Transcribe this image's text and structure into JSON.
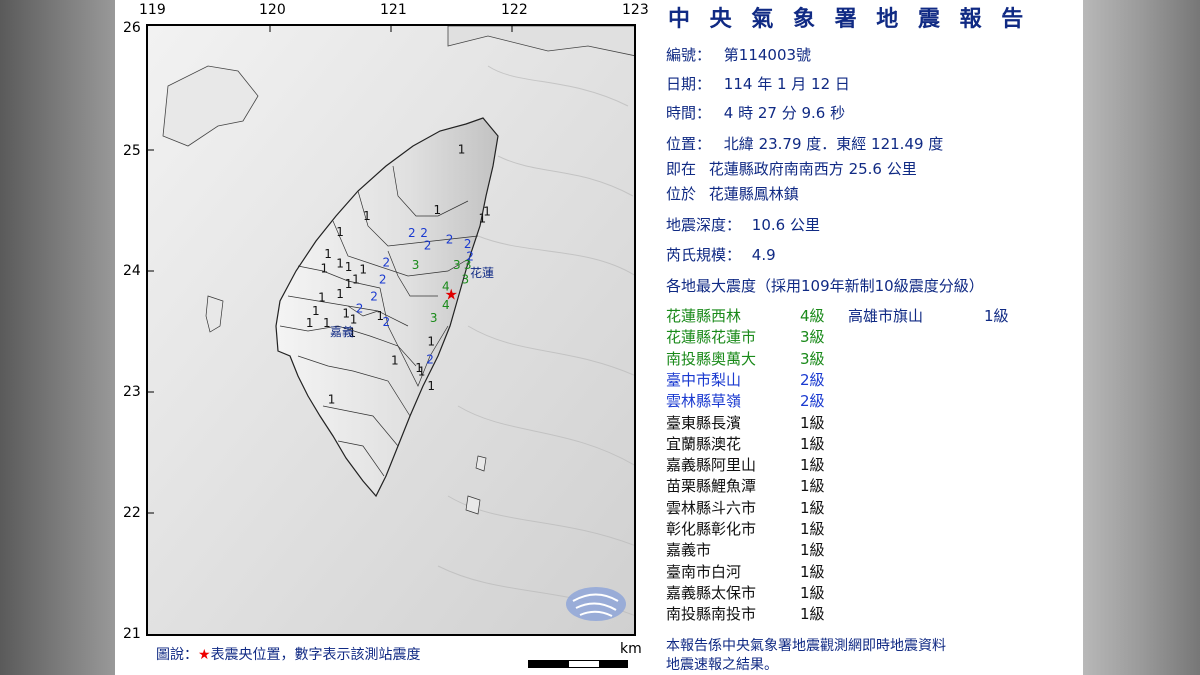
{
  "map": {
    "lon_ticks": [
      "119",
      "120",
      "121",
      "122",
      "123"
    ],
    "lat_ticks": [
      "26",
      "25",
      "24",
      "23",
      "22",
      "21"
    ],
    "epicenter_label": "花蓮",
    "city_label_chiayi": "嘉義",
    "legend_prefix": "圖說：",
    "legend_star": "★",
    "legend_text": "表震央位置，數字表示該測站震度",
    "scale_unit": "km",
    "stations": [
      {
        "v": "1",
        "lon": 121.55,
        "lat": 24.95
      },
      {
        "v": "1",
        "lon": 121.76,
        "lat": 24.44
      },
      {
        "v": "1",
        "lon": 121.72,
        "lat": 24.38
      },
      {
        "v": "1",
        "lon": 121.35,
        "lat": 24.45
      },
      {
        "v": "1",
        "lon": 120.77,
        "lat": 24.4
      },
      {
        "v": "1",
        "lon": 120.55,
        "lat": 24.27
      },
      {
        "v": "1",
        "lon": 120.45,
        "lat": 24.09
      },
      {
        "v": "1",
        "lon": 120.55,
        "lat": 24.01
      },
      {
        "v": "1",
        "lon": 120.42,
        "lat": 23.97
      },
      {
        "v": "1",
        "lon": 120.62,
        "lat": 23.98
      },
      {
        "v": "1",
        "lon": 120.74,
        "lat": 23.96
      },
      {
        "v": "1",
        "lon": 120.68,
        "lat": 23.88
      },
      {
        "v": "1",
        "lon": 120.62,
        "lat": 23.84
      },
      {
        "v": "1",
        "lon": 120.55,
        "lat": 23.76
      },
      {
        "v": "1",
        "lon": 120.4,
        "lat": 23.73
      },
      {
        "v": "1",
        "lon": 120.35,
        "lat": 23.62
      },
      {
        "v": "1",
        "lon": 120.3,
        "lat": 23.52
      },
      {
        "v": "1",
        "lon": 120.44,
        "lat": 23.52
      },
      {
        "v": "1",
        "lon": 120.6,
        "lat": 23.6
      },
      {
        "v": "1",
        "lon": 120.66,
        "lat": 23.55
      },
      {
        "v": "1",
        "lon": 120.65,
        "lat": 23.44
      },
      {
        "v": "1",
        "lon": 120.88,
        "lat": 23.58
      },
      {
        "v": "1",
        "lon": 121.3,
        "lat": 23.37
      },
      {
        "v": "1",
        "lon": 121.0,
        "lat": 23.21
      },
      {
        "v": "1",
        "lon": 121.2,
        "lat": 23.15
      },
      {
        "v": "1",
        "lon": 121.22,
        "lat": 23.12
      },
      {
        "v": "1",
        "lon": 121.3,
        "lat": 23.0
      },
      {
        "v": "1",
        "lon": 120.48,
        "lat": 22.89
      },
      {
        "v": "2",
        "lon": 121.14,
        "lat": 24.26
      },
      {
        "v": "2",
        "lon": 121.24,
        "lat": 24.26
      },
      {
        "v": "2",
        "lon": 121.27,
        "lat": 24.16
      },
      {
        "v": "2",
        "lon": 121.45,
        "lat": 24.21
      },
      {
        "v": "2",
        "lon": 121.6,
        "lat": 24.17
      },
      {
        "v": "2",
        "lon": 121.62,
        "lat": 24.07
      },
      {
        "v": "2",
        "lon": 120.93,
        "lat": 24.02
      },
      {
        "v": "2",
        "lon": 120.9,
        "lat": 23.88
      },
      {
        "v": "2",
        "lon": 120.83,
        "lat": 23.74
      },
      {
        "v": "2",
        "lon": 120.71,
        "lat": 23.64
      },
      {
        "v": "2",
        "lon": 120.93,
        "lat": 23.53
      },
      {
        "v": "2",
        "lon": 121.29,
        "lat": 23.22
      },
      {
        "v": "3",
        "lon": 121.17,
        "lat": 24.0
      },
      {
        "v": "3",
        "lon": 121.51,
        "lat": 24.0
      },
      {
        "v": "3",
        "lon": 121.6,
        "lat": 24.0
      },
      {
        "v": "3",
        "lon": 121.58,
        "lat": 23.88
      },
      {
        "v": "3",
        "lon": 121.32,
        "lat": 23.56
      },
      {
        "v": "4",
        "lon": 121.42,
        "lat": 23.82
      },
      {
        "v": "4",
        "lon": 121.42,
        "lat": 23.67
      }
    ],
    "epicenter": {
      "lon": 121.49,
      "lat": 23.79
    }
  },
  "report": {
    "title": "中 央 氣 象 署 地 震 報 告",
    "number_label": "編號：",
    "number_value": "第114003號",
    "date_label": "日期：",
    "date_value": "114 年 1 月 12 日",
    "time_label": "時間：",
    "time_value": "4 時 27 分 9.6 秒",
    "position_label": "位置：",
    "position_value": "北緯 23.79 度．東經 121.49 度",
    "near_label": "即在",
    "near_value": "花蓮縣政府南南西方 25.6 公里",
    "located_label": "位於",
    "located_value": "花蓮縣鳳林鎮",
    "depth_label": "地震深度：",
    "depth_value": "10.6 公里",
    "magnitude_label": "芮氏規模：",
    "magnitude_value": "4.9",
    "intensity_header": "各地最大震度（採用109年新制10級震度分級）",
    "extra_name": "高雄市旗山",
    "extra_level": "1級",
    "intensities": [
      {
        "name": "花蓮縣西林",
        "level": "4級",
        "cls": "c4"
      },
      {
        "name": "花蓮縣花蓮市",
        "level": "3級",
        "cls": "c3"
      },
      {
        "name": "南投縣奧萬大",
        "level": "3級",
        "cls": "c3"
      },
      {
        "name": "臺中市梨山",
        "level": "2級",
        "cls": "c2"
      },
      {
        "name": "雲林縣草嶺",
        "level": "2級",
        "cls": "c2"
      },
      {
        "name": "臺東縣長濱",
        "level": "1級",
        "cls": "c1"
      },
      {
        "name": "宜蘭縣澳花",
        "level": "1級",
        "cls": "c1"
      },
      {
        "name": "嘉義縣阿里山",
        "level": "1級",
        "cls": "c1"
      },
      {
        "name": "苗栗縣鯉魚潭",
        "level": "1級",
        "cls": "c1"
      },
      {
        "name": "雲林縣斗六市",
        "level": "1級",
        "cls": "c1"
      },
      {
        "name": "彰化縣彰化市",
        "level": "1級",
        "cls": "c1"
      },
      {
        "name": "嘉義市",
        "level": "1級",
        "cls": "c1"
      },
      {
        "name": "臺南市白河",
        "level": "1級",
        "cls": "c1"
      },
      {
        "name": "嘉義縣太保市",
        "level": "1級",
        "cls": "c1"
      },
      {
        "name": "南投縣南投市",
        "level": "1級",
        "cls": "c1"
      }
    ],
    "footnote_line1": "本報告係中央氣象署地震觀測網即時地震資料",
    "footnote_line2": "地震速報之結果。"
  },
  "colors": {
    "level4": "#1a8a1a",
    "level3": "#1a8a1a",
    "level2": "#1a3ad0",
    "level1": "#111111",
    "epicenter": "#e00000",
    "brand": "#102a84"
  }
}
